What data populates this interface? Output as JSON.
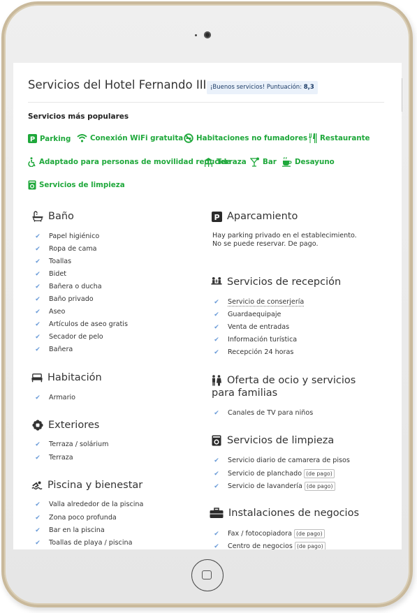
{
  "page": {
    "title": "Servicios del Hotel Fernando III",
    "score_text": "¡Buenos servicios! Puntuación:",
    "score_value": "8,3"
  },
  "popular": {
    "title": "Servicios más populares",
    "items": [
      "Parking",
      "Conexión WiFi gratuita",
      "Habitaciones no fumadores",
      "Restaurante",
      "Adaptado para personas de movilidad reducida",
      "Terraza",
      "Bar",
      "Desayuno",
      "Servicios de limpieza"
    ]
  },
  "left": {
    "bano": {
      "title": "Baño",
      "icon": "bath-icon",
      "items": [
        "Papel higiénico",
        "Ropa de cama",
        "Toallas",
        "Bidet",
        "Bañera o ducha",
        "Baño privado",
        "Aseo",
        "Artículos de aseo gratis",
        "Secador de pelo",
        "Bañera"
      ]
    },
    "habitacion": {
      "title": "Habitación",
      "icon": "bed-icon",
      "items": [
        "Armario"
      ]
    },
    "exteriores": {
      "title": "Exteriores",
      "icon": "flower-icon",
      "items": [
        "Terraza / solárium",
        "Terraza"
      ]
    },
    "piscina": {
      "title": "Piscina y bienestar",
      "icon": "swimmer-icon",
      "items": [
        "Valla alrededor de la piscina",
        "Zona poco profunda",
        "Bar en la piscina",
        "Toallas de playa / piscina"
      ]
    }
  },
  "right": {
    "aparcamiento": {
      "title": "Aparcamiento",
      "icon": "parking-icon",
      "text": "Hay parking privado en el establecimiento. No se puede reservar. De pago."
    },
    "recepcion": {
      "title": "Servicios de recepción",
      "icon": "reception-icon",
      "items": [
        "Servicio de conserjería",
        "Guardaequipaje",
        "Venta de entradas",
        "Información turística",
        "Recepción 24 horas"
      ]
    },
    "ocio": {
      "title_line1": "Oferta de ocio y servicios",
      "title_line2": "para familias",
      "icon": "family-icon",
      "items": [
        "Canales de TV para niños"
      ]
    },
    "limpieza": {
      "title": "Servicios de limpieza",
      "icon": "washer-icon",
      "items": [
        "Servicio diario de camarera de pisos",
        "Servicio de planchado",
        "Servicio de lavandería"
      ],
      "tag": "(de pago)"
    },
    "negocios": {
      "title": "Instalaciones de negocios",
      "icon": "briefcase-icon",
      "items": [
        "Fax / fotocopiadora",
        "Centro de negocios"
      ],
      "tag": "(de pago)"
    }
  },
  "colors": {
    "accent_green": "#1fa83b",
    "check_blue": "#6a9bd8",
    "badge_bg": "#eaf1fa",
    "bezel": "#c9b99b"
  }
}
